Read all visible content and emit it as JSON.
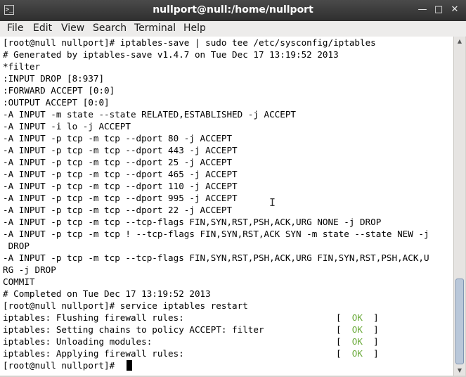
{
  "window": {
    "title": "nullport@null:/home/nullport",
    "icon_glyph": ">_",
    "controls": {
      "minimize": "—",
      "maximize": "□",
      "close": "✕"
    }
  },
  "menu": [
    "File",
    "Edit",
    "View",
    "Search",
    "Terminal",
    "Help"
  ],
  "terminal": {
    "lines": [
      "[root@null nullport]# iptables-save | sudo tee /etc/sysconfig/iptables",
      "# Generated by iptables-save v1.4.7 on Tue Dec 17 13:19:52 2013",
      "*filter",
      ":INPUT DROP [8:937]",
      ":FORWARD ACCEPT [0:0]",
      ":OUTPUT ACCEPT [0:0]",
      "-A INPUT -m state --state RELATED,ESTABLISHED -j ACCEPT",
      "-A INPUT -i lo -j ACCEPT",
      "-A INPUT -p tcp -m tcp --dport 80 -j ACCEPT",
      "-A INPUT -p tcp -m tcp --dport 443 -j ACCEPT",
      "-A INPUT -p tcp -m tcp --dport 25 -j ACCEPT",
      "-A INPUT -p tcp -m tcp --dport 465 -j ACCEPT",
      "-A INPUT -p tcp -m tcp --dport 110 -j ACCEPT",
      "-A INPUT -p tcp -m tcp --dport 995 -j ACCEPT",
      "-A INPUT -p tcp -m tcp --dport 22 -j ACCEPT",
      "-A INPUT -p tcp -m tcp --tcp-flags FIN,SYN,RST,PSH,ACK,URG NONE -j DROP",
      "-A INPUT -p tcp -m tcp ! --tcp-flags FIN,SYN,RST,ACK SYN -m state --state NEW -j",
      " DROP",
      "-A INPUT -p tcp -m tcp --tcp-flags FIN,SYN,RST,PSH,ACK,URG FIN,SYN,RST,PSH,ACK,U",
      "RG -j DROP",
      "COMMIT",
      "# Completed on Tue Dec 17 13:19:52 2013",
      "[root@null nullport]# service iptables restart",
      "iptables: Flushing firewall rules:",
      "iptables: Setting chains to policy ACCEPT: filter",
      "iptables: Unloading modules:",
      "iptables: Applying firewall rules:",
      "[root@null nullport]# "
    ],
    "status": {
      "open": "[",
      "word": "OK",
      "close": "]"
    },
    "ok_color": "#6aaa3a"
  },
  "icons": {
    "terminal": "terminal-icon",
    "pointer": "text-cursor-icon"
  }
}
